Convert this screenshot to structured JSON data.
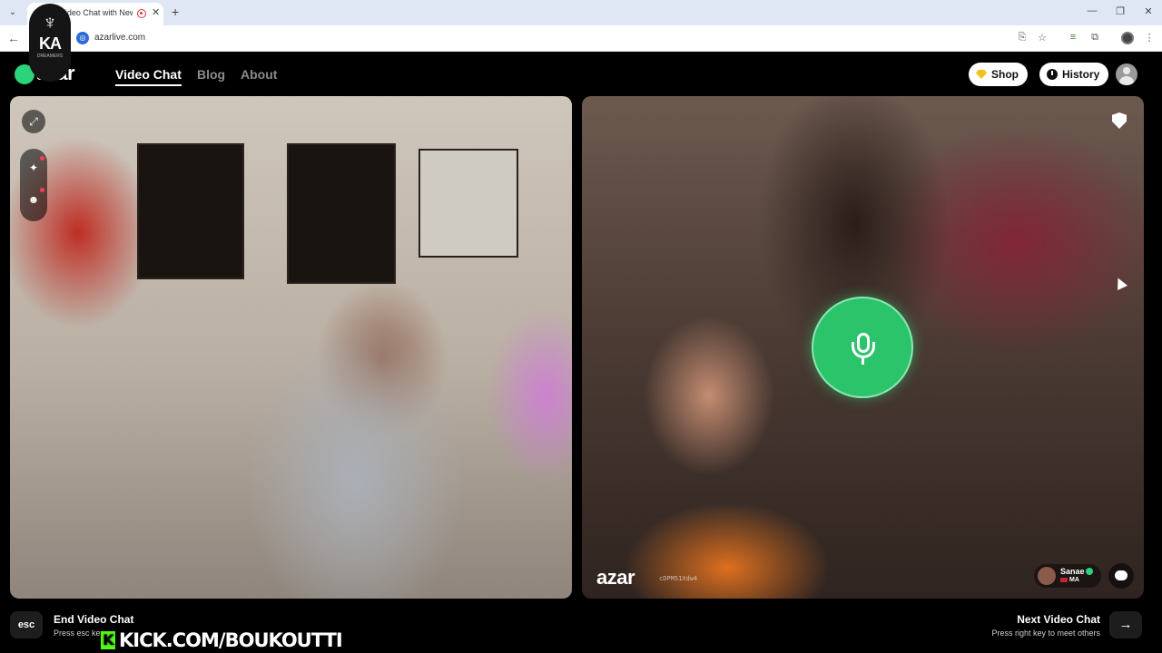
{
  "browser": {
    "tab_title": "Video Chat with New",
    "tab_close": "✕",
    "new_tab": "+",
    "url": "azarlive.com",
    "window_controls": {
      "minimize": "—",
      "restore": "❐",
      "close": "✕"
    }
  },
  "overlay": {
    "logo_letters": "KA",
    "logo_caption": "DREAMERS",
    "kick_handle": "KICK.COM/BOUKOUTTI",
    "kick_letter": "K"
  },
  "site": {
    "logo": "azar",
    "nav": [
      {
        "label": "Video Chat",
        "active": true
      },
      {
        "label": "Blog",
        "active": false
      },
      {
        "label": "About",
        "active": false
      }
    ],
    "shop_label": "Shop",
    "history_label": "History"
  },
  "left_panel": {
    "icons": [
      "expand-icon",
      "sparkle-effects-icon",
      "face-sticker-icon"
    ]
  },
  "right_panel": {
    "mic_state": "active",
    "watermark": "azar",
    "watermark_id": "cDPM51Xdw4",
    "partner": {
      "name": "Sanae",
      "country": "MA",
      "verified": true
    }
  },
  "bottom": {
    "end": {
      "key": "esc",
      "title": "End Video Chat",
      "subtitle": "Press esc key"
    },
    "next": {
      "title": "Next Video Chat",
      "subtitle": "Press right key to meet others",
      "icon": "→"
    }
  },
  "colors": {
    "accent_green": "#2cc46b",
    "kick_green": "#53fc18",
    "shop_gem": "#f4c21b"
  }
}
